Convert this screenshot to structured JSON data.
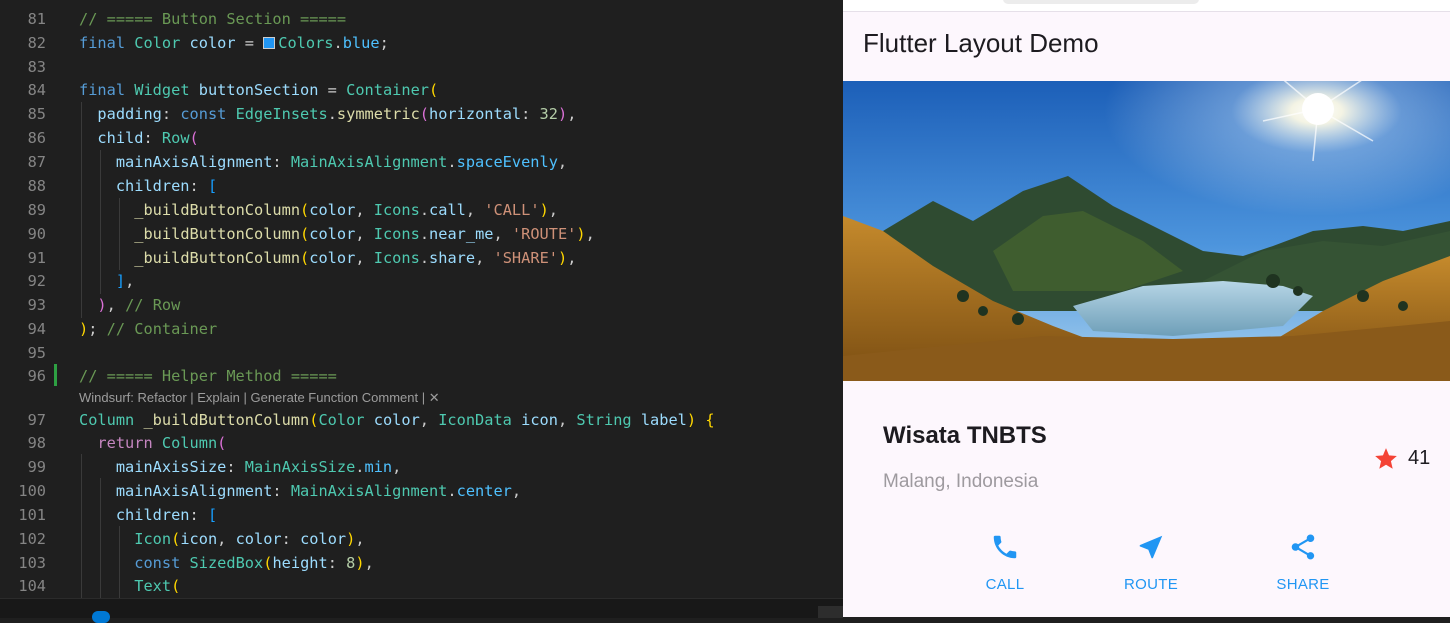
{
  "editor": {
    "lines": [
      {
        "n": "81",
        "tokens": [
          [
            "c-com",
            "// ===== Button Section ====="
          ]
        ]
      },
      {
        "n": "82",
        "tokens": [
          [
            "c-kw",
            "final "
          ],
          [
            "c-type",
            "Color "
          ],
          [
            "c-var",
            "color"
          ],
          [
            "",
            " = "
          ],
          [
            "swatch",
            ""
          ],
          [
            "c-type",
            "Colors"
          ],
          [
            "",
            "."
          ],
          [
            "c-prop",
            "blue"
          ],
          [
            "",
            ";"
          ]
        ]
      },
      {
        "n": "83",
        "tokens": []
      },
      {
        "n": "84",
        "tokens": [
          [
            "c-kw",
            "final "
          ],
          [
            "c-type",
            "Widget "
          ],
          [
            "c-var",
            "buttonSection"
          ],
          [
            "",
            " = "
          ],
          [
            "c-type",
            "Container"
          ],
          [
            "b1",
            "("
          ]
        ]
      },
      {
        "n": "85",
        "tokens": [
          [
            "",
            "  "
          ],
          [
            "c-var",
            "padding"
          ],
          [
            "",
            ": "
          ],
          [
            "c-kw",
            "const "
          ],
          [
            "c-type",
            "EdgeInsets"
          ],
          [
            "",
            "."
          ],
          [
            "c-fn",
            "symmetric"
          ],
          [
            "b2",
            "("
          ],
          [
            "c-var",
            "horizontal"
          ],
          [
            "",
            ": "
          ],
          [
            "c-num",
            "32"
          ],
          [
            "b2",
            ")"
          ],
          [
            "",
            ","
          ]
        ]
      },
      {
        "n": "86",
        "tokens": [
          [
            "",
            "  "
          ],
          [
            "c-var",
            "child"
          ],
          [
            "",
            ": "
          ],
          [
            "c-type",
            "Row"
          ],
          [
            "b2",
            "("
          ]
        ]
      },
      {
        "n": "87",
        "tokens": [
          [
            "",
            "    "
          ],
          [
            "c-var",
            "mainAxisAlignment"
          ],
          [
            "",
            ": "
          ],
          [
            "c-type",
            "MainAxisAlignment"
          ],
          [
            "",
            "."
          ],
          [
            "c-prop",
            "spaceEvenly"
          ],
          [
            "",
            ","
          ]
        ]
      },
      {
        "n": "88",
        "tokens": [
          [
            "",
            "    "
          ],
          [
            "c-var",
            "children"
          ],
          [
            "",
            ": "
          ],
          [
            "b3",
            "["
          ]
        ]
      },
      {
        "n": "89",
        "tokens": [
          [
            "",
            "      "
          ],
          [
            "c-fn",
            "_buildButtonColumn"
          ],
          [
            "b1",
            "("
          ],
          [
            "c-var",
            "color"
          ],
          [
            "",
            ", "
          ],
          [
            "c-type",
            "Icons"
          ],
          [
            "",
            "."
          ],
          [
            "c-var",
            "call"
          ],
          [
            "",
            ", "
          ],
          [
            "c-str",
            "'CALL'"
          ],
          [
            "b1",
            ")"
          ],
          [
            "",
            ","
          ]
        ]
      },
      {
        "n": "90",
        "tokens": [
          [
            "",
            "      "
          ],
          [
            "c-fn",
            "_buildButtonColumn"
          ],
          [
            "b1",
            "("
          ],
          [
            "c-var",
            "color"
          ],
          [
            "",
            ", "
          ],
          [
            "c-type",
            "Icons"
          ],
          [
            "",
            "."
          ],
          [
            "c-var",
            "near_me"
          ],
          [
            "",
            ", "
          ],
          [
            "c-str",
            "'ROUTE'"
          ],
          [
            "b1",
            ")"
          ],
          [
            "",
            ","
          ]
        ]
      },
      {
        "n": "91",
        "tokens": [
          [
            "",
            "      "
          ],
          [
            "c-fn",
            "_buildButtonColumn"
          ],
          [
            "b1",
            "("
          ],
          [
            "c-var",
            "color"
          ],
          [
            "",
            ", "
          ],
          [
            "c-type",
            "Icons"
          ],
          [
            "",
            "."
          ],
          [
            "c-var",
            "share"
          ],
          [
            "",
            ", "
          ],
          [
            "c-str",
            "'SHARE'"
          ],
          [
            "b1",
            ")"
          ],
          [
            "",
            ","
          ]
        ]
      },
      {
        "n": "92",
        "tokens": [
          [
            "",
            "    "
          ],
          [
            "b3",
            "]"
          ],
          [
            "",
            ","
          ]
        ]
      },
      {
        "n": "93",
        "tokens": [
          [
            "",
            "  "
          ],
          [
            "b2",
            ")"
          ],
          [
            "",
            ", "
          ],
          [
            "c-com",
            "// Row"
          ]
        ]
      },
      {
        "n": "94",
        "tokens": [
          [
            "b1",
            ")"
          ],
          [
            "",
            "; "
          ],
          [
            "c-com",
            "// Container"
          ]
        ]
      },
      {
        "n": "95",
        "tokens": []
      },
      {
        "n": "96",
        "tokens": [
          [
            "c-com",
            "// ===== Helper Method ====="
          ]
        ]
      },
      {
        "n": "97",
        "tokens": [
          [
            "c-type",
            "Column "
          ],
          [
            "c-fn",
            "_buildButtonColumn"
          ],
          [
            "b1",
            "("
          ],
          [
            "c-type",
            "Color "
          ],
          [
            "c-var",
            "color"
          ],
          [
            "",
            ", "
          ],
          [
            "c-type",
            "IconData "
          ],
          [
            "c-var",
            "icon"
          ],
          [
            "",
            ", "
          ],
          [
            "c-type",
            "String "
          ],
          [
            "c-var",
            "label"
          ],
          [
            "b1",
            ")"
          ],
          [
            "",
            " "
          ],
          [
            "b1",
            "{"
          ]
        ]
      },
      {
        "n": "98",
        "tokens": [
          [
            "",
            "  "
          ],
          [
            "c-ctl",
            "return "
          ],
          [
            "c-type",
            "Column"
          ],
          [
            "b2",
            "("
          ]
        ]
      },
      {
        "n": "99",
        "tokens": [
          [
            "",
            "    "
          ],
          [
            "c-var",
            "mainAxisSize"
          ],
          [
            "",
            ": "
          ],
          [
            "c-type",
            "MainAxisSize"
          ],
          [
            "",
            "."
          ],
          [
            "c-prop",
            "min"
          ],
          [
            "",
            ","
          ]
        ]
      },
      {
        "n": "100",
        "tokens": [
          [
            "",
            "    "
          ],
          [
            "c-var",
            "mainAxisAlignment"
          ],
          [
            "",
            ": "
          ],
          [
            "c-type",
            "MainAxisAlignment"
          ],
          [
            "",
            "."
          ],
          [
            "c-prop",
            "center"
          ],
          [
            "",
            ","
          ]
        ]
      },
      {
        "n": "101",
        "tokens": [
          [
            "",
            "    "
          ],
          [
            "c-var",
            "children"
          ],
          [
            "",
            ": "
          ],
          [
            "b3",
            "["
          ]
        ]
      },
      {
        "n": "102",
        "tokens": [
          [
            "",
            "      "
          ],
          [
            "c-type",
            "Icon"
          ],
          [
            "b1",
            "("
          ],
          [
            "c-var",
            "icon"
          ],
          [
            "",
            ", "
          ],
          [
            "c-var",
            "color"
          ],
          [
            "",
            ": "
          ],
          [
            "c-var",
            "color"
          ],
          [
            "b1",
            ")"
          ],
          [
            "",
            ","
          ]
        ]
      },
      {
        "n": "103",
        "tokens": [
          [
            "",
            "      "
          ],
          [
            "c-kw",
            "const "
          ],
          [
            "c-type",
            "SizedBox"
          ],
          [
            "b1",
            "("
          ],
          [
            "c-var",
            "height"
          ],
          [
            "",
            ": "
          ],
          [
            "c-num",
            "8"
          ],
          [
            "b1",
            ")"
          ],
          [
            "",
            ","
          ]
        ]
      },
      {
        "n": "104",
        "tokens": [
          [
            "",
            "      "
          ],
          [
            "c-type",
            "Text"
          ],
          [
            "b1",
            "("
          ]
        ]
      }
    ],
    "codelens": "Windsurf: Refactor | Explain | Generate Function Comment | ✕",
    "swatch_color": "#2196f3"
  },
  "app": {
    "title": "Flutter Layout Demo",
    "place_name": "Wisata TNBTS",
    "location": "Malang, Indonesia",
    "favorite_count": "41",
    "accent_color": "#2196f3",
    "star_color": "#f44336",
    "buttons": [
      {
        "label": "CALL",
        "icon": "call-icon"
      },
      {
        "label": "ROUTE",
        "icon": "near-me-icon"
      },
      {
        "label": "SHARE",
        "icon": "share-icon"
      }
    ]
  }
}
